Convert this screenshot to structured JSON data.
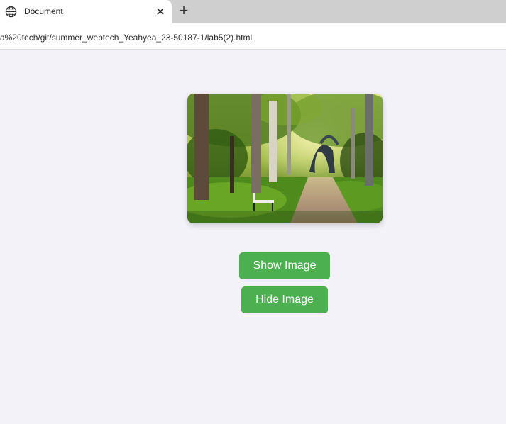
{
  "browser": {
    "tab": {
      "title": "Document",
      "icon": "globe-icon"
    },
    "new_tab_icon": "plus-icon",
    "close_icon": "close-icon",
    "url": "a%20tech/git/summer_webtech_Yeahyea_23-50187-1/lab5(2).html"
  },
  "page": {
    "image": {
      "subject": "forest-park-path-with-bench",
      "visible": true
    },
    "buttons": {
      "show_label": "Show Image",
      "hide_label": "Hide Image"
    },
    "colors": {
      "button_bg": "#4caf50",
      "page_bg": "#f3f2f8"
    }
  }
}
